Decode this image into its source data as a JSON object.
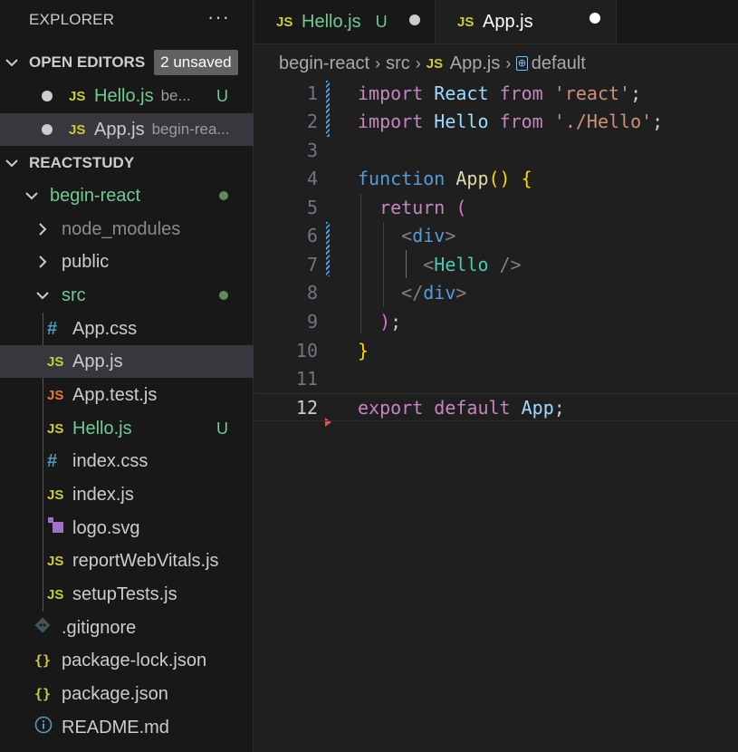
{
  "sidebar": {
    "title": "EXPLORER",
    "more": "···",
    "open_editors": {
      "label": "OPEN EDITORS",
      "badge": "2 unsaved",
      "items": [
        {
          "icon": "JS",
          "name": "Hello.js",
          "path": "be...",
          "status": "U"
        },
        {
          "icon": "JS",
          "name": "App.js",
          "path": "begin-rea..."
        }
      ]
    },
    "workspace": {
      "label": "REACTSTUDY",
      "tree": [
        {
          "name": "begin-react"
        },
        {
          "name": "node_modules"
        },
        {
          "name": "public"
        },
        {
          "name": "src"
        },
        {
          "icon": "#",
          "name": "App.css"
        },
        {
          "icon": "JS",
          "name": "App.js"
        },
        {
          "icon": "JS",
          "name": "App.test.js"
        },
        {
          "icon": "JS",
          "name": "Hello.js",
          "status": "U"
        },
        {
          "icon": "#",
          "name": "index.css"
        },
        {
          "icon": "JS",
          "name": "index.js"
        },
        {
          "name": "logo.svg"
        },
        {
          "icon": "JS",
          "name": "reportWebVitals.js"
        },
        {
          "icon": "JS",
          "name": "setupTests.js"
        },
        {
          "name": ".gitignore"
        },
        {
          "icon": "{}",
          "name": "package-lock.json"
        },
        {
          "icon": "{}",
          "name": "package.json"
        },
        {
          "name": "README.md"
        }
      ]
    }
  },
  "tabs": [
    {
      "icon": "JS",
      "label": "Hello.js",
      "status": "U"
    },
    {
      "icon": "JS",
      "label": "App.js"
    }
  ],
  "breadcrumb": {
    "parts": [
      "begin-react",
      "src",
      "App.js",
      "default"
    ],
    "file_icon": "JS"
  },
  "editor": {
    "line_numbers": [
      "1",
      "2",
      "3",
      "4",
      "5",
      "6",
      "7",
      "8",
      "9",
      "10",
      "11",
      "12"
    ],
    "lines": {
      "l1": [
        "import",
        "React",
        "from",
        "'react'",
        ";"
      ],
      "l2": [
        "import",
        "Hello",
        "from",
        "'./Hello'",
        ";"
      ],
      "l4": [
        "function",
        "App",
        "(",
        ")",
        "{"
      ],
      "l5": [
        "return",
        "("
      ],
      "l6": [
        "<",
        "div",
        ">"
      ],
      "l7": [
        "<",
        "Hello",
        "/>"
      ],
      "l8": [
        "</",
        "div",
        ">"
      ],
      "l9": [
        ")",
        ";"
      ],
      "l10": [
        "}"
      ],
      "l12": [
        "export",
        "default",
        "App",
        ";"
      ]
    }
  },
  "colors": {
    "keyword_purple": "#c586c0",
    "keyword_blue": "#569cd6",
    "variable": "#9cdcfe",
    "string": "#ce9178",
    "function": "#dcdcaa",
    "component": "#4ec9b0",
    "git_untracked": "#73c991",
    "js_icon": "#cbcb41"
  }
}
